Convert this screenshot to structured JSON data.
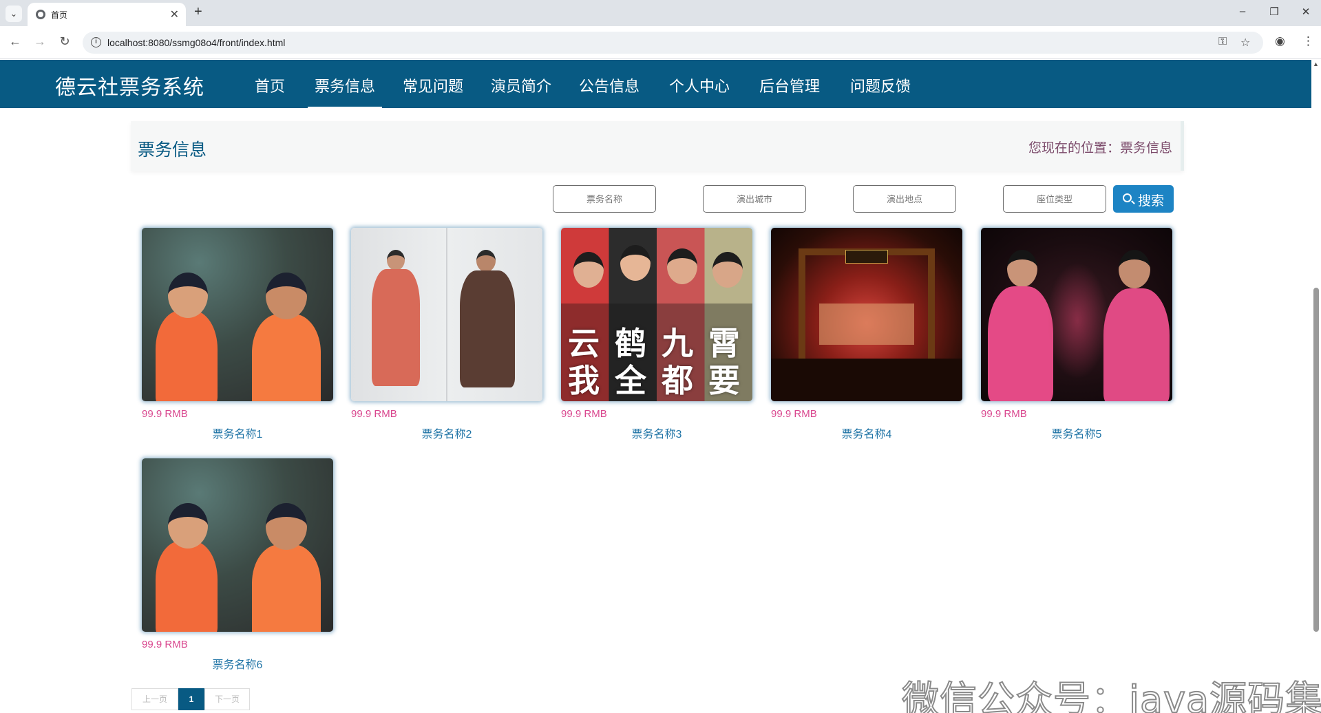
{
  "browser": {
    "tab_title": "首页",
    "url": "localhost:8080/ssmg08o4/front/index.html"
  },
  "header": {
    "logo": "德云社票务系统",
    "nav": [
      {
        "label": "首页"
      },
      {
        "label": "票务信息"
      },
      {
        "label": "常见问题"
      },
      {
        "label": "演员简介"
      },
      {
        "label": "公告信息"
      },
      {
        "label": "个人中心"
      },
      {
        "label": "后台管理"
      },
      {
        "label": "问题反馈"
      }
    ],
    "active_nav": "票务信息"
  },
  "title_strip": {
    "title": "票务信息",
    "breadcrumb": "您现在的位置：票务信息"
  },
  "search": {
    "fields": [
      {
        "placeholder": "票务名称"
      },
      {
        "placeholder": "演出城市"
      },
      {
        "placeholder": "演出地点"
      },
      {
        "placeholder": "座位类型"
      }
    ],
    "button_label": "搜索"
  },
  "products": [
    {
      "price": "99.9 RMB",
      "name": "票务名称1",
      "image": "two performers in orange robes"
    },
    {
      "price": "99.9 RMB",
      "name": "票务名称2",
      "image": "two performers in long robes"
    },
    {
      "price": "99.9 RMB",
      "name": "票务名称3",
      "image": "four young performers with characters"
    },
    {
      "price": "99.9 RMB",
      "name": "票务名称4",
      "image": "theater stage"
    },
    {
      "price": "99.9 RMB",
      "name": "票务名称5",
      "image": "two performers in pink robes poster"
    },
    {
      "price": "99.9 RMB",
      "name": "票务名称6",
      "image": "two performers in orange robes"
    }
  ],
  "image3_overlay": [
    "云",
    "鹤",
    "九",
    "霄",
    "我",
    "全",
    "都",
    "要"
  ],
  "pagination": {
    "prev": "上一页",
    "current": "1",
    "next": "下一页"
  },
  "watermark": "微信公众号：java源码集合"
}
